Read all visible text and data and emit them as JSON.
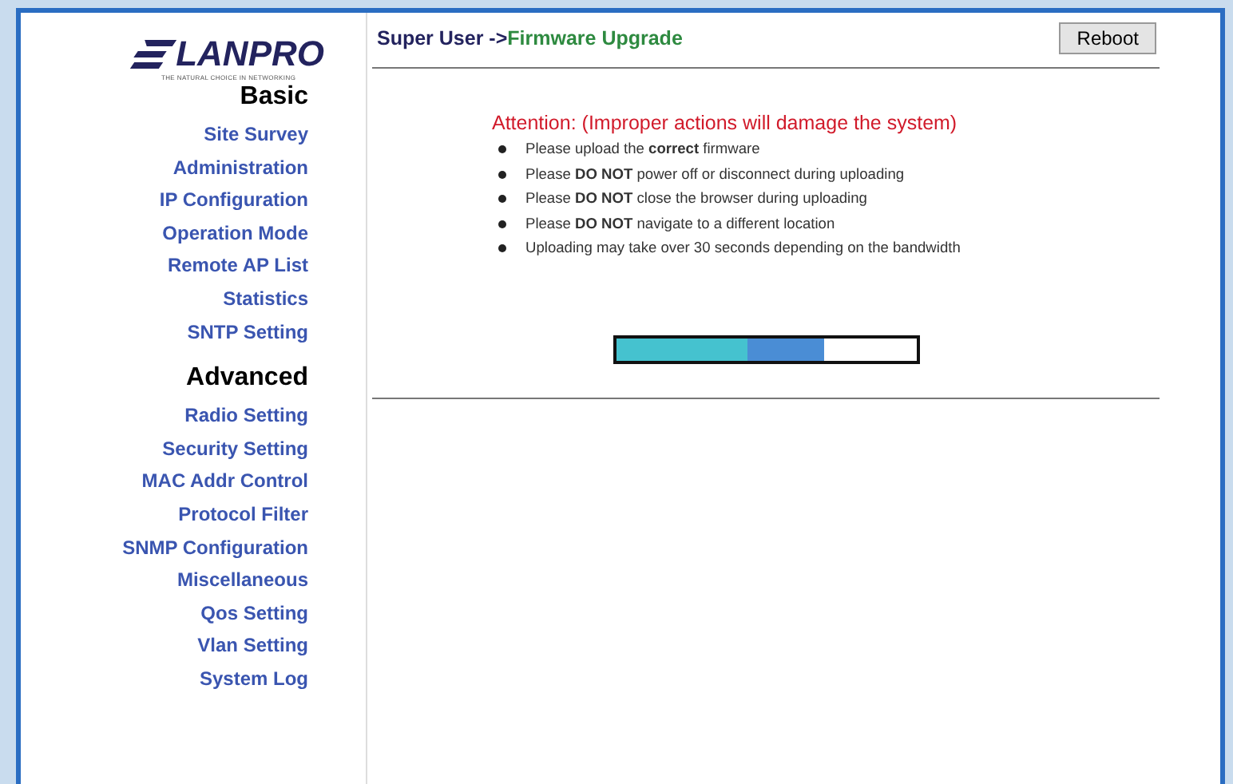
{
  "logo": {
    "name": "LANPRO",
    "slogan": "THE NATURAL CHOICE IN NETWORKING"
  },
  "sidebar": {
    "sections": [
      {
        "heading": "Basic",
        "items": [
          "Site Survey",
          "Administration",
          "IP Configuration",
          "Operation Mode",
          "Remote AP List",
          "Statistics",
          "SNTP Setting"
        ]
      },
      {
        "heading": "Advanced",
        "items": [
          "Radio Setting",
          "Security Setting",
          "MAC Addr Control",
          "Protocol Filter",
          "SNMP Configuration",
          "Miscellaneous",
          "Qos Setting",
          "Vlan Setting",
          "System Log"
        ]
      }
    ]
  },
  "header": {
    "breadcrumb_parent": "Super User ->",
    "breadcrumb_current": "Firmware Upgrade",
    "button": "Reboot"
  },
  "attention": "Attention: (Improper actions will damage the system)",
  "notes": [
    "Please upload the **correct** firmware",
    "Please **DO NOT** power off or disconnect during uploading",
    "Please **DO NOT** close the browser during uploading",
    "Please **DO NOT** navigate to a different location",
    "Uploading may take over 30 seconds depending on the bandwidth"
  ],
  "progress": {
    "level": 0.69
  }
}
